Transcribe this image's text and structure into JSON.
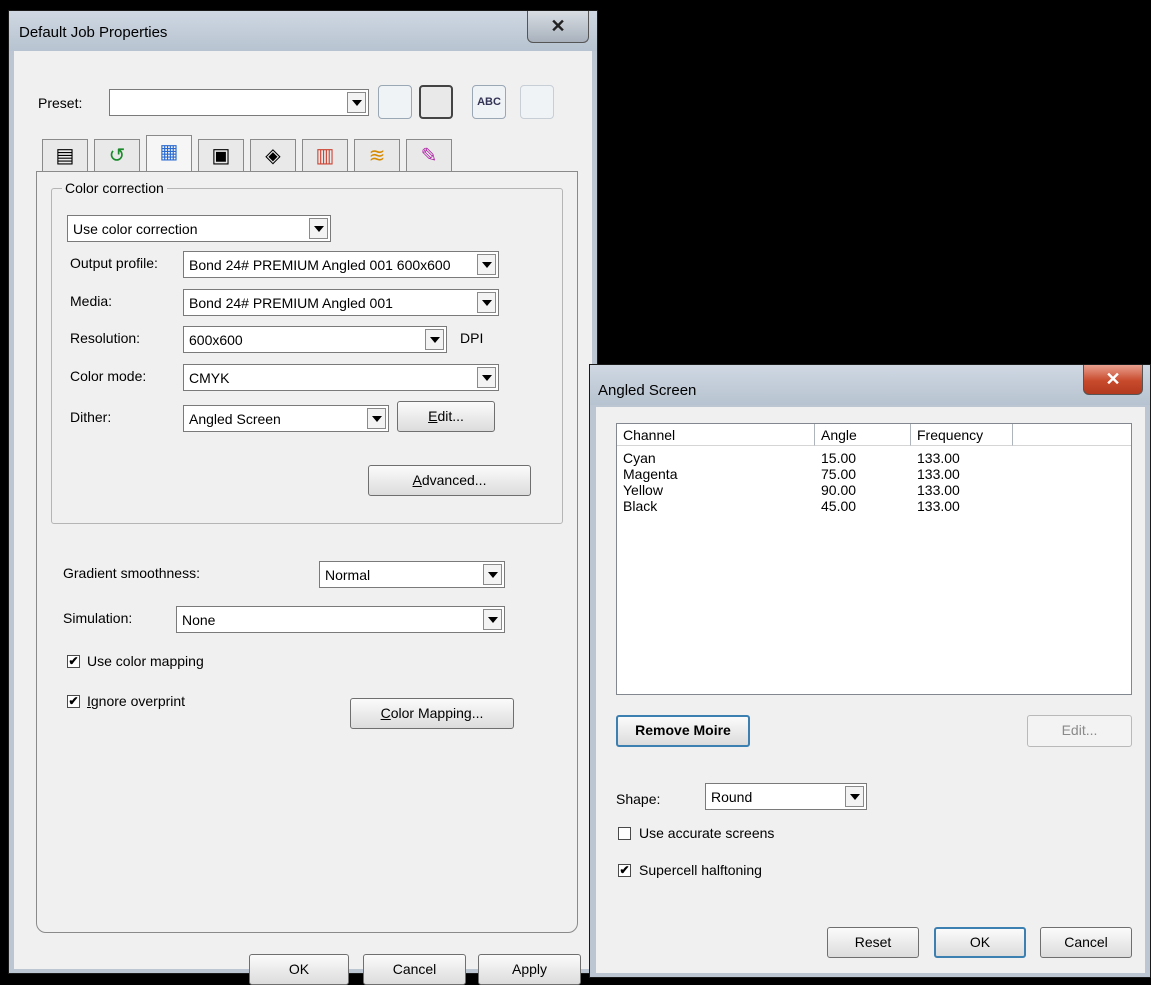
{
  "main": {
    "title": "Default Job Properties",
    "close": "✕",
    "preset_label": "Preset:",
    "preset_value": "",
    "preset_icons": [
      "save-icon",
      "save-as-icon",
      "rename-icon",
      "delete-icon"
    ],
    "preset_icon_glyphs": [
      "▭",
      "▭",
      "ABC",
      "🗑"
    ],
    "tabs": [
      {
        "name": "page-layout",
        "glyph": "▤"
      },
      {
        "name": "transform",
        "glyph": "↺"
      },
      {
        "name": "color",
        "glyph": "▦"
      },
      {
        "name": "printer",
        "glyph": "▣"
      },
      {
        "name": "marks",
        "glyph": "◈"
      },
      {
        "name": "bars",
        "glyph": "▥"
      },
      {
        "name": "layers",
        "glyph": "≋"
      },
      {
        "name": "color-picker",
        "glyph": "✎"
      }
    ],
    "color_correction": {
      "group_label": "Color correction",
      "mode": "Use color correction",
      "output_profile_label": "Output profile:",
      "output_profile": "Bond 24# PREMIUM Angled 001 600x600",
      "media_label": "Media:",
      "media": "Bond 24# PREMIUM Angled 001",
      "resolution_label": "Resolution:",
      "resolution": "600x600",
      "resolution_unit": "DPI",
      "color_mode_label": "Color mode:",
      "color_mode": "CMYK",
      "dither_label": "Dither:",
      "dither": "Angled Screen",
      "edit_pre": "",
      "edit_u": "E",
      "edit_post": "dit...",
      "advanced_pre": "",
      "advanced_u": "A",
      "advanced_post": "dvanced..."
    },
    "gradient_label": "Gradient smoothness:",
    "gradient": "Normal",
    "simulation_label": "Simulation:",
    "simulation": "None",
    "use_color_mapping": {
      "label": "Use color mapping",
      "checked": "✔"
    },
    "ignore_overprint": {
      "label_u": "I",
      "label_rest": "gnore overprint",
      "checked": "✔"
    },
    "color_mapping_u": "C",
    "color_mapping_rest": "olor Mapping...",
    "ok": "OK",
    "cancel": "Cancel",
    "apply": "Apply"
  },
  "dialog": {
    "title": "Angled Screen",
    "close": "✕",
    "columns": [
      "Channel",
      "Angle",
      "Frequency"
    ],
    "rows": [
      {
        "channel": "Cyan",
        "angle": "15.00",
        "frequency": "133.00"
      },
      {
        "channel": "Magenta",
        "angle": "75.00",
        "frequency": "133.00"
      },
      {
        "channel": "Yellow",
        "angle": "90.00",
        "frequency": "133.00"
      },
      {
        "channel": "Black",
        "angle": "45.00",
        "frequency": "133.00"
      }
    ],
    "remove_moire": "Remove Moire",
    "edit": "Edit...",
    "shape_label": "Shape:",
    "shape": "Round",
    "accurate_screens": {
      "label": "Use accurate screens",
      "checked": ""
    },
    "supercell": {
      "label": "Supercell halftoning",
      "checked": "✔"
    },
    "reset": "Reset",
    "ok": "OK",
    "cancel": "Cancel"
  }
}
